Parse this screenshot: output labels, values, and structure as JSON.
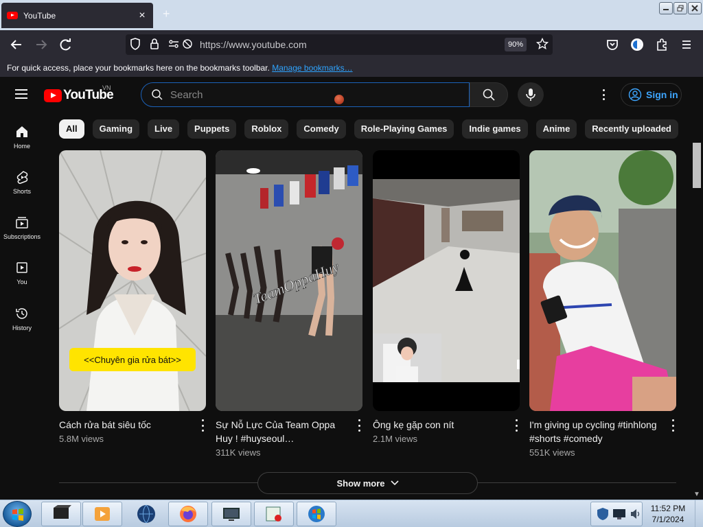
{
  "browser": {
    "tab_title": "YouTube",
    "tab_close": "×",
    "new_tab": "+",
    "url": "https://www.youtube.com",
    "zoom": "90%",
    "bookmarks_msg": "For quick access, place your bookmarks here on the bookmarks toolbar.",
    "manage_bookmarks": "Manage bookmarks…"
  },
  "youtube": {
    "logo_text": "YouTube",
    "country_code": "VN",
    "search_placeholder": "Search",
    "sign_in": "Sign in",
    "sidebar": [
      {
        "label": "Home"
      },
      {
        "label": "Shorts"
      },
      {
        "label": "Subscriptions"
      },
      {
        "label": "You"
      },
      {
        "label": "History"
      }
    ],
    "chips": [
      "All",
      "Gaming",
      "Live",
      "Puppets",
      "Roblox",
      "Comedy",
      "Role-Playing Games",
      "Indie games",
      "Anime",
      "Recently uploaded"
    ],
    "videos": [
      {
        "title": "Cách rửa bát siêu tốc",
        "views": "5.8M views",
        "overlay_text": "<<Chuyên gia rửa bát>>"
      },
      {
        "title": "Sự Nỗ Lực Của Team Oppa Huy ! #huyseoul…",
        "views": "311K views",
        "overlay_text": "TeamOppaHuy"
      },
      {
        "title": "Ông kẹ gặp con nít",
        "views": "2.1M views"
      },
      {
        "title": "I'm giving up cycling #tinhlong #shorts #comedy",
        "views": "551K views"
      }
    ],
    "show_more": "Show more"
  },
  "taskbar": {
    "time": "11:52 PM",
    "date": "7/1/2024"
  },
  "colors": {
    "yt_bg": "#0f0f0f",
    "yt_red": "#ff0000",
    "link_blue": "#3ea6ff",
    "firefox_chrome": "#2b2a33"
  }
}
